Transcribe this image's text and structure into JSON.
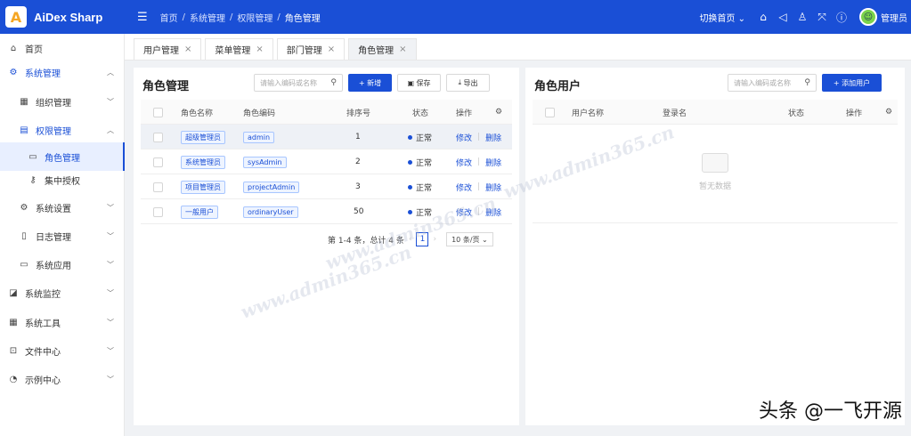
{
  "app": {
    "name": "AiDex Sharp",
    "logo_letter": "A"
  },
  "header": {
    "breadcrumb": [
      "首页",
      "系统管理",
      "权限管理",
      "角色管理"
    ],
    "switch_home": "切换首页",
    "user": "管理员"
  },
  "sidebar": {
    "items": [
      {
        "label": "首页"
      },
      {
        "label": "系统管理"
      },
      {
        "label": "组织管理"
      },
      {
        "label": "权限管理"
      },
      {
        "label": "角色管理"
      },
      {
        "label": "集中授权"
      },
      {
        "label": "系统设置"
      },
      {
        "label": "日志管理"
      },
      {
        "label": "系统应用"
      },
      {
        "label": "系统监控"
      },
      {
        "label": "系统工具"
      },
      {
        "label": "文件中心"
      },
      {
        "label": "示例中心"
      }
    ]
  },
  "tabs": [
    {
      "label": "用户管理"
    },
    {
      "label": "菜单管理"
    },
    {
      "label": "部门管理"
    },
    {
      "label": "角色管理"
    }
  ],
  "roles_panel": {
    "title": "角色管理",
    "search_placeholder": "请输入编码或名称",
    "btn_add": "+ 新增",
    "btn_save": "保存",
    "btn_export": "导出",
    "columns": [
      "角色名称",
      "角色编码",
      "排序号",
      "状态",
      "操作"
    ],
    "rows": [
      {
        "name": "超级管理员",
        "code": "admin",
        "order": "1",
        "status": "正常",
        "edit": "修改",
        "del": "删除"
      },
      {
        "name": "系统管理员",
        "code": "sysAdmin",
        "order": "2",
        "status": "正常",
        "edit": "修改",
        "del": "删除"
      },
      {
        "name": "项目管理员",
        "code": "projectAdmin",
        "order": "3",
        "status": "正常",
        "edit": "修改",
        "del": "删除"
      },
      {
        "name": "一般用户",
        "code": "ordinaryUser",
        "order": "50",
        "status": "正常",
        "edit": "修改",
        "del": "删除"
      }
    ],
    "pagination": {
      "summary": "第 1-4 条，总计 4 条",
      "page": "1",
      "page_size": "10 条/页"
    }
  },
  "users_panel": {
    "title": "角色用户",
    "search_placeholder": "请输入编码或名称",
    "btn_add": "+ 添加用户",
    "columns": [
      "用户名称",
      "登录名",
      "状态",
      "操作"
    ],
    "empty_text": "暂无数据"
  },
  "watermark": "www.admin365.cn",
  "caption": "头条 @一飞开源"
}
